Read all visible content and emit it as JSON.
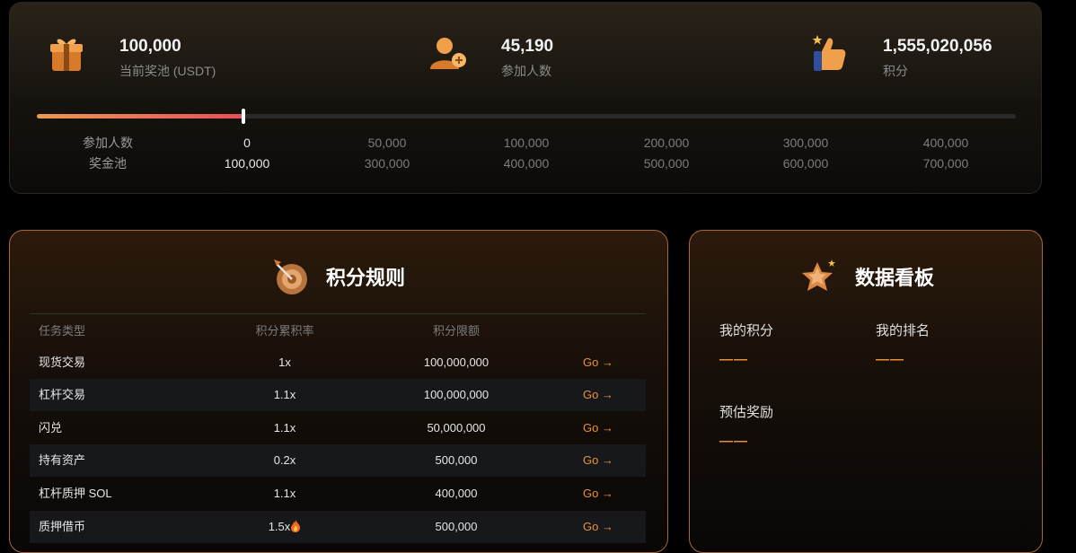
{
  "stats": [
    {
      "value": "100,000",
      "label": "当前奖池 (USDT)",
      "icon": "gift-box-icon"
    },
    {
      "value": "45,190",
      "label": "参加人数",
      "icon": "add-user-icon"
    },
    {
      "value": "1,555,020,056",
      "label": "积分",
      "icon": "thumbs-up-icon"
    }
  ],
  "progress": {
    "fraction": 0.211,
    "row_labels": {
      "participants": "参加人数",
      "prize_pool": "奖金池"
    },
    "ticks": [
      {
        "participants": "0",
        "prize": "100,000"
      },
      {
        "participants": "50,000",
        "prize": "300,000"
      },
      {
        "participants": "100,000",
        "prize": "400,000"
      },
      {
        "participants": "200,000",
        "prize": "500,000"
      },
      {
        "participants": "300,000",
        "prize": "600,000"
      },
      {
        "participants": "400,000",
        "prize": "700,000"
      }
    ]
  },
  "rules": {
    "title": "积分规则",
    "icon": "target-dart-icon",
    "headers": [
      "任务类型",
      "积分累积率",
      "积分限额"
    ],
    "go_label": "Go →",
    "rows": [
      {
        "task": "现货交易",
        "rate": "1x",
        "limit": "100,000,000",
        "hot": false
      },
      {
        "task": "杠杆交易",
        "rate": "1.1x",
        "limit": "100,000,000",
        "hot": false
      },
      {
        "task": "闪兑",
        "rate": "1.1x",
        "limit": "50,000,000",
        "hot": false
      },
      {
        "task": "持有资产",
        "rate": "0.2x",
        "limit": "500,000",
        "hot": false
      },
      {
        "task": "杠杆质押 SOL",
        "rate": "1.1x",
        "limit": "400,000",
        "hot": false
      },
      {
        "task": "质押借币",
        "rate": "1.5x",
        "limit": "500,000",
        "hot": true
      }
    ]
  },
  "dashboard": {
    "title": "数据看板",
    "icon": "star-icon",
    "my_points_label": "我的积分",
    "my_points_value": "——",
    "my_rank_label": "我的排名",
    "my_rank_value": "——",
    "est_reward_label": "预估奖励",
    "est_reward_value": "——"
  },
  "colors": {
    "accent": "#e8923a",
    "progress_start": "#e99a52",
    "progress_end": "#e6505a",
    "card_border": "#a7693b"
  }
}
